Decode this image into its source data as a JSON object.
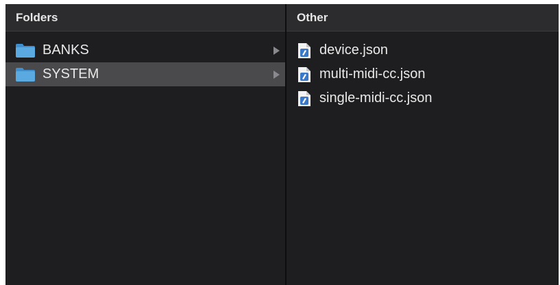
{
  "folders_pane": {
    "header": "Folders",
    "items": [
      {
        "label": "BANKS",
        "icon": "folder-icon",
        "selected": false
      },
      {
        "label": "SYSTEM",
        "icon": "folder-icon",
        "selected": true
      }
    ]
  },
  "other_pane": {
    "header": "Other",
    "items": [
      {
        "label": "device.json",
        "icon": "json-file-icon"
      },
      {
        "label": "multi-midi-cc.json",
        "icon": "json-file-icon"
      },
      {
        "label": "single-midi-cc.json",
        "icon": "json-file-icon"
      }
    ]
  },
  "colors": {
    "background": "#1e1e20",
    "header": "#2c2c2e",
    "selected_row": "#4a4a4c",
    "folder_blue": "#5aa9e0",
    "text": "#e8e8e8"
  }
}
